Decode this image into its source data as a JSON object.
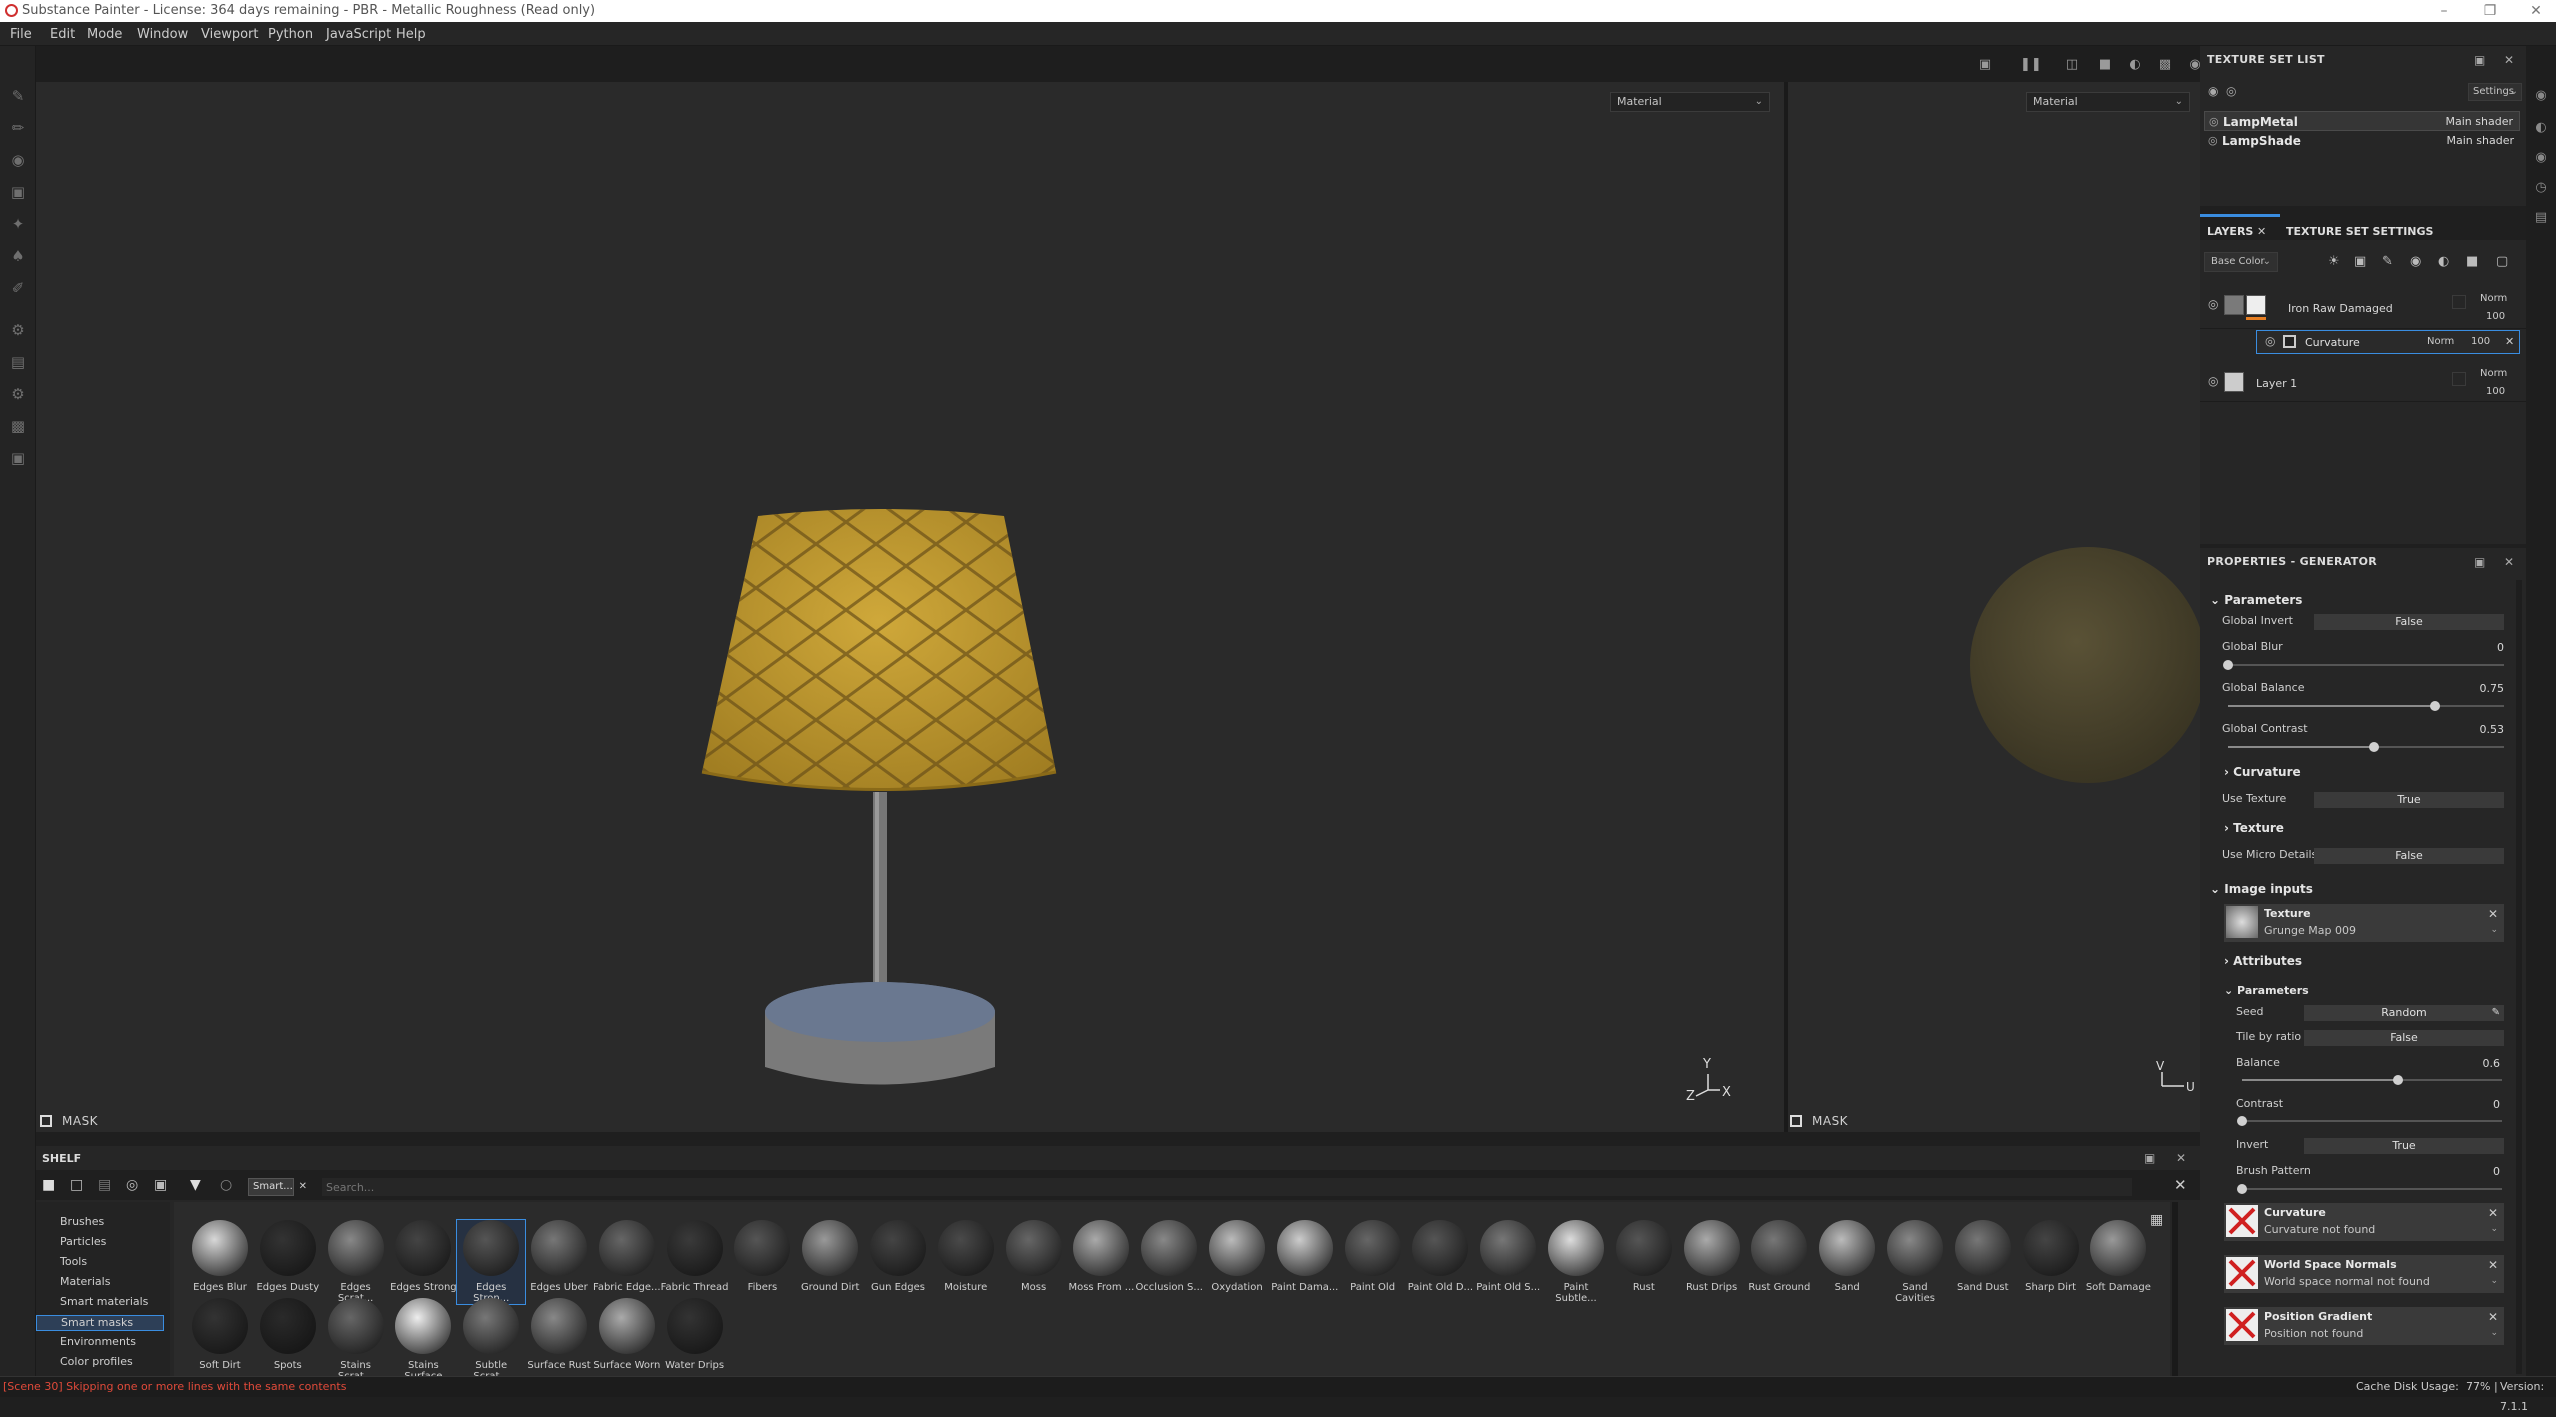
{
  "window": {
    "title": "Substance Painter - License: 364 days remaining - PBR - Metallic Roughness (Read only)"
  },
  "menu": [
    "File",
    "Edit",
    "Mode",
    "Window",
    "Viewport",
    "Python",
    "JavaScript",
    "Help"
  ],
  "viewport": {
    "mode_3d": "Material",
    "mode_2d": "Material",
    "mask_label_3d": "MASK",
    "mask_label_2d": "MASK",
    "axis_3d": [
      "Z",
      "Y",
      "X"
    ],
    "axis_2d": [
      "V",
      "U"
    ]
  },
  "texture_set_list": {
    "title": "TEXTURE SET LIST",
    "settings_label": "Settings",
    "items": [
      {
        "name": "LampMetal",
        "shader": "Main shader"
      },
      {
        "name": "LampShade",
        "shader": "Main shader"
      }
    ]
  },
  "layers": {
    "tab_layers": "LAYERS",
    "tab_texture_set_settings": "TEXTURE SET SETTINGS",
    "channel": "Base Color",
    "rows": [
      {
        "name": "Iron Raw Damaged",
        "blend": "Norm",
        "opacity": "100"
      },
      {
        "name": "Curvature",
        "blend": "Norm",
        "opacity": "100"
      },
      {
        "name": "Layer 1",
        "blend": "Norm",
        "opacity": "100"
      }
    ]
  },
  "properties": {
    "title": "PROPERTIES - GENERATOR",
    "parameters_label": "Parameters",
    "global_invert": {
      "label": "Global Invert",
      "value": "False"
    },
    "global_blur": {
      "label": "Global Blur",
      "value": "0",
      "fraction": 0
    },
    "global_balance": {
      "label": "Global Balance",
      "value": "0.75",
      "fraction": 0.75
    },
    "global_contrast": {
      "label": "Global Contrast",
      "value": "0.53",
      "fraction": 0.53
    },
    "curvature_section": "Curvature",
    "use_texture": {
      "label": "Use Texture",
      "value": "True"
    },
    "texture_section": "Texture",
    "use_micro_details": {
      "label": "Use Micro Details",
      "value": "False"
    },
    "image_inputs_label": "Image inputs",
    "texture_input": {
      "title": "Texture",
      "value": "Grunge Map 009"
    },
    "attributes_label": "Attributes",
    "sub_parameters_label": "Parameters",
    "seed": {
      "label": "Seed",
      "value": "Random"
    },
    "tile_by_ratio": {
      "label": "Tile by ratio",
      "value": "False"
    },
    "balance": {
      "label": "Balance",
      "value": "0.6",
      "fraction": 0.6
    },
    "contrast": {
      "label": "Contrast",
      "value": "0",
      "fraction": 0
    },
    "invert": {
      "label": "Invert",
      "value": "True"
    },
    "brush_pattern": {
      "label": "Brush Pattern",
      "value": "0",
      "fraction": 0
    },
    "inputs": [
      {
        "title": "Curvature",
        "value": "Curvature not found"
      },
      {
        "title": "World Space Normals",
        "value": "World space normal not found"
      },
      {
        "title": "Position Gradient",
        "value": "Position not found"
      }
    ]
  },
  "shelf": {
    "title": "SHELF",
    "filter_tag": "Smart...",
    "search_placeholder": "Search...",
    "categories": [
      "Brushes",
      "Particles",
      "Tools",
      "Materials",
      "Smart materials",
      "Smart masks",
      "Environments",
      "Color profiles"
    ],
    "selected_category": "Smart masks",
    "row1": [
      "Edges Blur",
      "Edges Dusty",
      "Edges Scrat...",
      "Edges Strong",
      "Edges Stron...",
      "Edges Uber",
      "Fabric Edge...",
      "Fabric Thread",
      "Fibers",
      "Ground Dirt",
      "Gun Edges",
      "Moisture",
      "Moss",
      "Moss From ...",
      "Occlusion S...",
      "Oxydation",
      "Paint Dama...",
      "Paint Old",
      "Paint Old D...",
      "Paint Old S...",
      "Paint Subtle...",
      "Rust",
      "Rust Drips",
      "Rust Ground",
      "Sand",
      "Sand Cavities",
      "Sand Dust",
      "Sharp Dirt",
      "Soft Damage"
    ],
    "row2": [
      "Soft Dirt",
      "Spots",
      "Stains Scrat...",
      "Stains Surface",
      "Subtle Scrat...",
      "Surface Rust",
      "Surface Worn",
      "Water Drips"
    ]
  },
  "status": {
    "message": "[Scene 30] Skipping one or more lines with the same contents",
    "cache": "Cache Disk Usage:",
    "cache_value": "77%",
    "version": "Version: 7.1.1"
  }
}
